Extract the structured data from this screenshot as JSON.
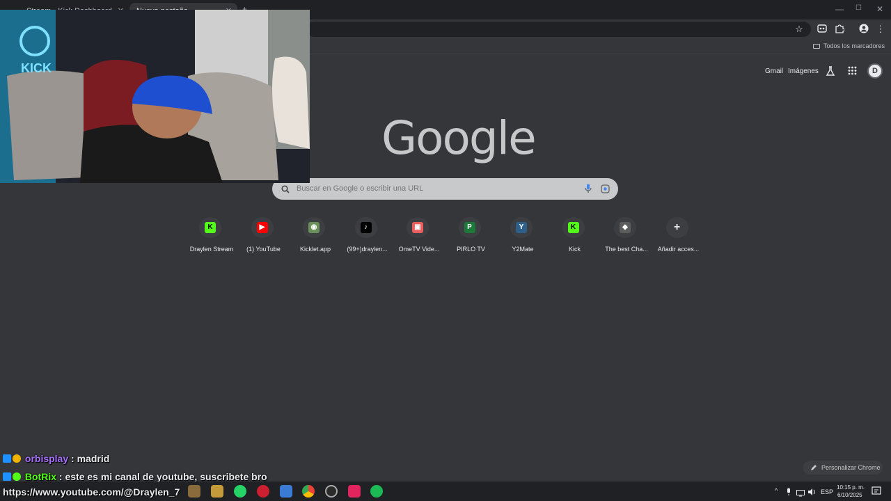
{
  "window": {
    "tabs": [
      {
        "label": "Stream - Kick Dashboard",
        "active": false
      },
      {
        "label": "Nueva pestaña",
        "active": true
      }
    ],
    "new_tab_symbol": "+",
    "controls": {
      "minimize": "—",
      "maximize": "☐",
      "close": "✕"
    }
  },
  "toolbar": {
    "bookmark_icon": "star-icon",
    "menu_symbol": "⋮",
    "star_symbol": "☆"
  },
  "bookmarks_bar": {
    "all_bookmarks": "Todos los marcadores"
  },
  "ntp": {
    "header_links": {
      "gmail": "Gmail",
      "images": "Imágenes"
    },
    "profile_initial": "D",
    "logo": "Google",
    "search_placeholder": "Buscar en Google o escribir una URL",
    "shortcuts": [
      {
        "label": "Draylen Stream",
        "glyph": "K",
        "color": "#53fc18",
        "icon": "kick-icon"
      },
      {
        "label": "(1) YouTube",
        "glyph": "▶",
        "color": "#ff0000",
        "icon": "youtube-icon"
      },
      {
        "label": "Kicklet.app",
        "glyph": "◉",
        "color": "#6a8f5a",
        "icon": "kicklet-icon"
      },
      {
        "label": "(99+)draylen...",
        "glyph": "♪",
        "color": "#000000",
        "icon": "tiktok-icon"
      },
      {
        "label": "OmeTV Vide...",
        "glyph": "▣",
        "color": "#e85d5d",
        "icon": "ometv-icon"
      },
      {
        "label": "PIRLO TV",
        "glyph": "P",
        "color": "#1b7a3a",
        "icon": "pirlo-icon"
      },
      {
        "label": "Y2Mate",
        "glyph": "Y",
        "color": "#2d5f8a",
        "icon": "y2mate-icon"
      },
      {
        "label": "Kick",
        "glyph": "K",
        "color": "#53fc18",
        "icon": "kick-icon"
      },
      {
        "label": "The best Cha...",
        "glyph": "◆",
        "color": "#5c5c5c",
        "icon": "chatgpt-icon"
      },
      {
        "label": "Añadir acces...",
        "glyph": "+",
        "color": "#3c4a5e",
        "icon": "add-icon"
      }
    ],
    "customize_label": "Personalizar Chrome"
  },
  "chat": [
    {
      "user": "orbisplay",
      "separator": " : ",
      "message": "madrid",
      "user_color": "#a970ff"
    },
    {
      "user": "BotRix",
      "separator": " : ",
      "message": "este es mi canal de youtube, suscribete bro",
      "user_color": "#53fc18"
    },
    {
      "user": "",
      "separator": "",
      "message": "https://www.youtube.com/@Draylen_7",
      "user_color": "#ffffff"
    }
  ],
  "taskbar": {
    "apps": [
      "file-explorer-icon",
      "files-icon",
      "whatsapp-icon",
      "opera-icon",
      "app-icon",
      "chrome-icon",
      "obs-icon",
      "tiktok-icon",
      "spotify-icon"
    ],
    "tray": {
      "language": "ESP",
      "time": "10:15 p. m.",
      "date": "6/10/2025",
      "chevron": "^"
    }
  }
}
